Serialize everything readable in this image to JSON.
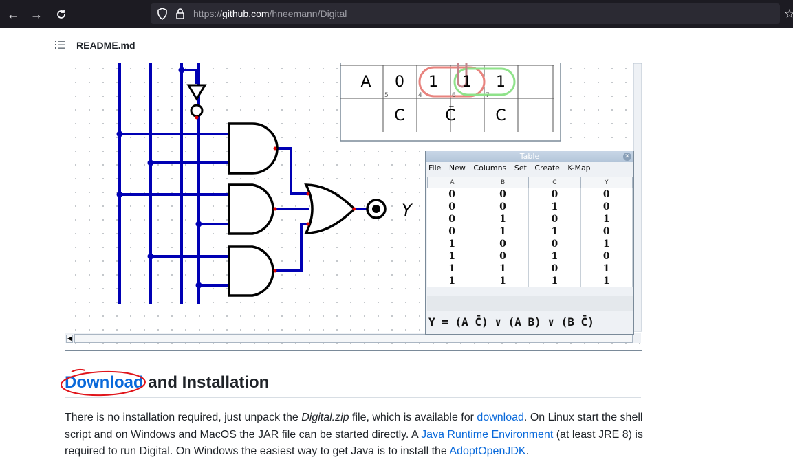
{
  "browser": {
    "url_prefix": "https://",
    "url_host": "github.com",
    "url_path": "/hneemann/Digital"
  },
  "readme": {
    "title": "README.md"
  },
  "kmap": {
    "row_label": "A",
    "cells": [
      "0",
      "1",
      "1",
      "1"
    ],
    "small_indices": [
      "5",
      "4",
      "6",
      "7"
    ],
    "col_labels": [
      "C",
      "C̄",
      "C"
    ]
  },
  "circuit": {
    "output_label": "Y"
  },
  "table_window": {
    "title": "Table",
    "menu": [
      "File",
      "New",
      "Columns",
      "Set",
      "Create",
      "K-Map"
    ],
    "headers": [
      "A",
      "B",
      "C",
      "Y"
    ],
    "rows": [
      [
        "0",
        "0",
        "0",
        "0"
      ],
      [
        "0",
        "0",
        "1",
        "0"
      ],
      [
        "0",
        "1",
        "0",
        "1"
      ],
      [
        "0",
        "1",
        "1",
        "0"
      ],
      [
        "1",
        "0",
        "0",
        "1"
      ],
      [
        "1",
        "0",
        "1",
        "0"
      ],
      [
        "1",
        "1",
        "0",
        "1"
      ],
      [
        "1",
        "1",
        "1",
        "1"
      ]
    ],
    "formula": "Y = (A C̄) ∨ (A B) ∨ (B C̄)"
  },
  "section": {
    "heading_link": "Download",
    "heading_rest": " and Installation"
  },
  "paragraph": {
    "t1": "There is no installation required, just unpack the ",
    "t2": "Digital.zip",
    "t3": " file, which is available for ",
    "link1": "download",
    "t4": ". On Linux start the shell script and on Windows and MacOS the JAR file can be started directly. A ",
    "link2": "Java Runtime Environment",
    "t5": " (at least JRE 8) is required to run Digital. On Windows the easiest way to get Java is to install the ",
    "link3": "AdoptOpenJDK",
    "t6": "."
  },
  "colors": {
    "wire": "#0000b4",
    "link": "#0969da",
    "annotation": "#e0151b"
  }
}
